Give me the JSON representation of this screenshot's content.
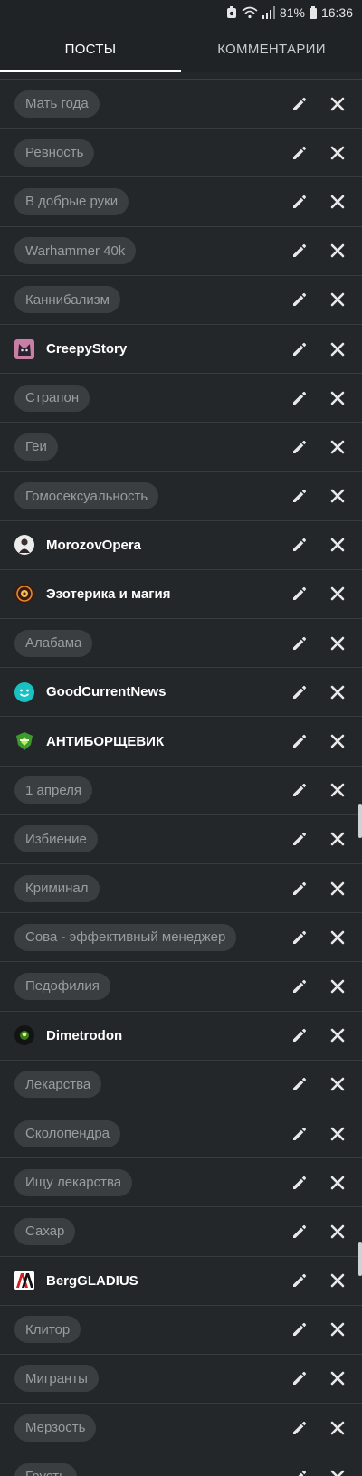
{
  "status": {
    "battery": "81%",
    "time": "16:36"
  },
  "tabs": [
    {
      "label": "ПОСТЫ",
      "active": true
    },
    {
      "label": "КОММЕНТАРИИ",
      "active": false
    }
  ],
  "items": [
    {
      "type": "tag",
      "label": "Мать года"
    },
    {
      "type": "tag",
      "label": "Ревность"
    },
    {
      "type": "tag",
      "label": "В добрые руки"
    },
    {
      "type": "tag",
      "label": "Warhammer 40k"
    },
    {
      "type": "tag",
      "label": "Каннибализм"
    },
    {
      "type": "community",
      "label": "CreepyStory",
      "icon": "cat-avatar-icon"
    },
    {
      "type": "tag",
      "label": "Страпон"
    },
    {
      "type": "tag",
      "label": "Геи"
    },
    {
      "type": "tag",
      "label": "Гомосексуальность"
    },
    {
      "type": "community",
      "label": "MorozovOpera",
      "icon": "person-avatar-icon"
    },
    {
      "type": "community",
      "label": "Эзотерика и магия",
      "icon": "magic-circle-icon"
    },
    {
      "type": "tag",
      "label": "Алабама"
    },
    {
      "type": "community",
      "label": "GoodCurrentNews",
      "icon": "smile-avatar-icon"
    },
    {
      "type": "community",
      "label": "АНТИБОРЩЕВИК",
      "icon": "leaf-shield-icon"
    },
    {
      "type": "tag",
      "label": "1 апреля"
    },
    {
      "type": "tag",
      "label": "Избиение"
    },
    {
      "type": "tag",
      "label": "Криминал"
    },
    {
      "type": "tag",
      "label": "Сова - эффективный менеджер"
    },
    {
      "type": "tag",
      "label": "Педофилия"
    },
    {
      "type": "community",
      "label": "Dimetrodon",
      "icon": "glow-avatar-icon"
    },
    {
      "type": "tag",
      "label": "Лекарства"
    },
    {
      "type": "tag",
      "label": "Сколопендра"
    },
    {
      "type": "tag",
      "label": "Ищу лекарства"
    },
    {
      "type": "tag",
      "label": "Сахар"
    },
    {
      "type": "community",
      "label": "BergGLADIUS",
      "icon": "aa-logo-icon"
    },
    {
      "type": "tag",
      "label": "Клитор"
    },
    {
      "type": "tag",
      "label": "Мигранты"
    },
    {
      "type": "tag",
      "label": "Мерзость"
    },
    {
      "type": "tag",
      "label": "Грусть"
    }
  ],
  "colors": {
    "background": "#23272a",
    "chip_bg": "#3a3e41",
    "chip_text": "#9a9da0",
    "divider": "#383c40"
  }
}
